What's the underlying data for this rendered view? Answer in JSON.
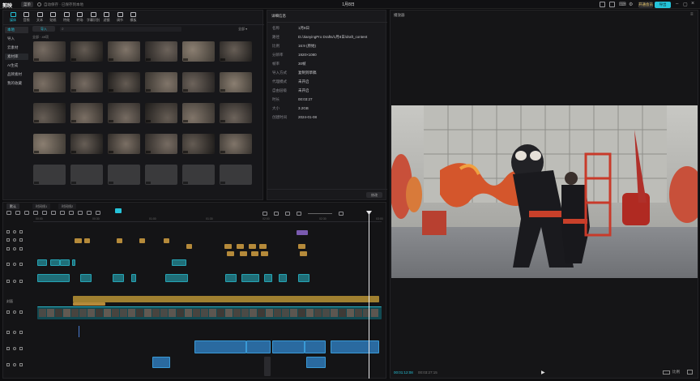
{
  "app": {
    "name": "剪映",
    "menu_label": "菜单",
    "autosave": "自动保存 · 已保存到本地",
    "project_title": "1月8日"
  },
  "titlebar_right": {
    "layout_label": "",
    "pro_label": "开通会员",
    "export_label": "导出"
  },
  "media": {
    "tools": [
      {
        "label": "媒体",
        "icon": "media-icon",
        "active": true
      },
      {
        "label": "音频",
        "icon": "audio-icon"
      },
      {
        "label": "文本",
        "icon": "text-icon"
      },
      {
        "label": "贴纸",
        "icon": "sticker-icon"
      },
      {
        "label": "特效",
        "icon": "effects-icon"
      },
      {
        "label": "转场",
        "icon": "transition-icon"
      },
      {
        "label": "字幕识别",
        "icon": "captions-icon"
      },
      {
        "label": "滤镜",
        "icon": "filter-icon"
      },
      {
        "label": "调节",
        "icon": "adjust-icon"
      },
      {
        "label": "模板",
        "icon": "template-icon"
      }
    ],
    "sidebar": [
      {
        "label": "本地",
        "state": "sel"
      },
      {
        "label": "导入",
        "state": ""
      },
      {
        "label": "云素材",
        "state": ""
      },
      {
        "label": "素材库",
        "state": "hl"
      },
      {
        "label": "AI生成",
        "state": ""
      },
      {
        "label": "品牌素材",
        "state": ""
      },
      {
        "label": "我的收藏",
        "state": ""
      }
    ],
    "import_label": "导入",
    "filter_label": "全部 ▾",
    "path_label": "全部 · 49项"
  },
  "details": {
    "header": "详细信息",
    "rows": [
      {
        "key": "名称",
        "value": "1月8日"
      },
      {
        "key": "路径",
        "value": "D:/JianyingPro Drafts/1月8日/draft_content"
      },
      {
        "key": "比例",
        "value": "16:9 (原始)"
      },
      {
        "key": "分辨率",
        "value": "1920×1080"
      },
      {
        "key": "帧率",
        "value": "30帧"
      },
      {
        "key": "导入方式",
        "value": "复制到草稿"
      },
      {
        "key": "代理模式",
        "value": "未开启"
      },
      {
        "key": "自由层级",
        "value": "未开启"
      },
      {
        "key": "时长",
        "value": "00:03:27"
      },
      {
        "key": "大小",
        "value": "3.2GB"
      },
      {
        "key": "创建时间",
        "value": "2024-01-08"
      }
    ],
    "modify_label": "修改"
  },
  "player": {
    "title": "播放器",
    "timecode": "00:01:12:08",
    "duration": "00:03:27:15",
    "ratio_label": "比例"
  },
  "timeline": {
    "tabs": [
      "默认",
      "时间线1",
      "时间线2"
    ],
    "track_labels": [
      "",
      "",
      "",
      "",
      "",
      "",
      "",
      "",
      ""
    ],
    "ruler_marks": [
      "00:00",
      "00:30",
      "01:00",
      "01:30",
      "02:00",
      "02:30",
      "03:00"
    ],
    "cover_label": "封面"
  },
  "colors": {
    "accent": "#25c3d9",
    "panel": "#17171a",
    "clip_yellow": "#b58a3a",
    "clip_teal": "#1f6e78",
    "clip_blue": "#2a6aa0"
  }
}
